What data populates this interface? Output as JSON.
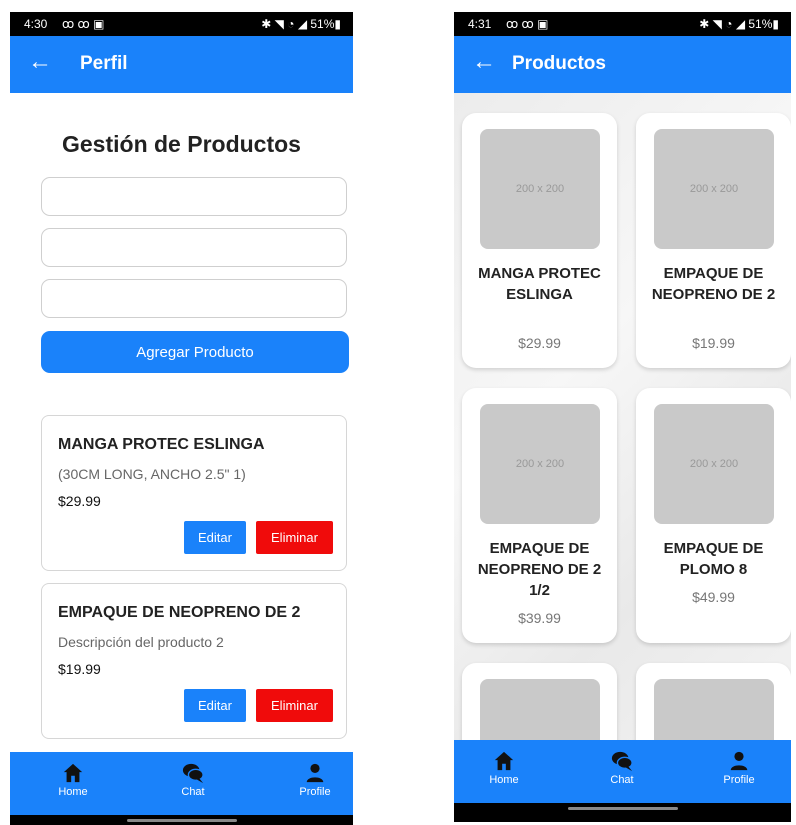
{
  "status_left": {
    "time": "4:30",
    "icons": "ꝏ ꝏ ▣",
    "system": "✱ ◥ ◔ ◢ 51%▮"
  },
  "status_right": {
    "time": "4:31",
    "icons": "ꝏ ꝏ ▣",
    "system": "✱ ◥ ◔ ◢ 51%▮"
  },
  "left_screen": {
    "appbar_title": "Perfil",
    "form_title": "Gestión de Productos",
    "inputs": [
      {
        "value": ""
      },
      {
        "value": ""
      },
      {
        "value": ""
      }
    ],
    "add_button": "Agregar Producto",
    "products": [
      {
        "name": "MANGA PROTEC ESLINGA",
        "description": "(30CM LONG, ANCHO 2.5\" 1)",
        "price": "$29.99",
        "edit": "Editar",
        "delete": "Eliminar"
      },
      {
        "name": "EMPAQUE DE NEOPRENO DE 2",
        "description": "Descripción del producto 2",
        "price": "$19.99",
        "edit": "Editar",
        "delete": "Eliminar"
      }
    ]
  },
  "right_screen": {
    "appbar_title": "Productos",
    "placeholder_text": "200 x 200",
    "products": [
      {
        "name": "MANGA PROTEC ESLINGA",
        "price": "$29.99"
      },
      {
        "name": "EMPAQUE DE NEOPRENO DE 2",
        "price": "$19.99"
      },
      {
        "name": "EMPAQUE DE NEOPRENO DE 2 1/2",
        "price": "$39.99"
      },
      {
        "name": "EMPAQUE DE PLOMO 8",
        "price": "$49.99"
      }
    ]
  },
  "nav": {
    "home": "Home",
    "chat": "Chat",
    "profile": "Profile"
  },
  "colors": {
    "accent": "#1a82fa",
    "danger": "#f00b0b"
  },
  "icons": {
    "back": "arrow-left-icon",
    "home": "home-icon",
    "chat": "chat-bubbles-icon",
    "profile": "user-icon"
  }
}
